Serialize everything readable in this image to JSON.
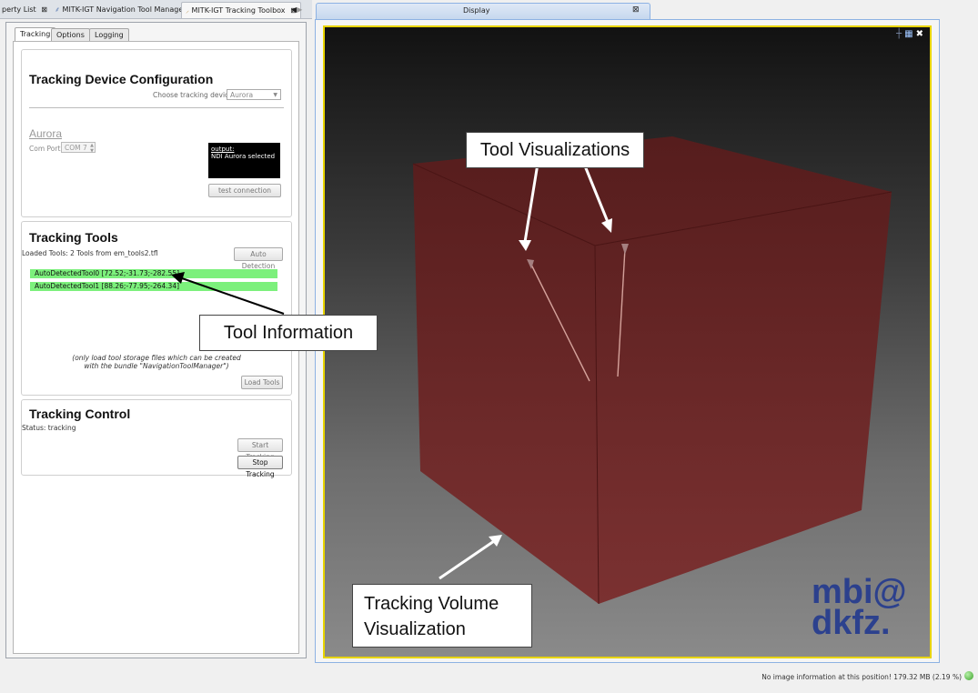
{
  "top_tabs": {
    "tab1": "perty List",
    "tab2": "MITK-IGT Navigation Tool Manager",
    "tab3": "MITK-IGT Tracking Toolbox"
  },
  "sub_tabs": [
    "Tracking",
    "Options",
    "Logging"
  ],
  "device_config": {
    "title": "Tracking Device Configuration",
    "choose_label": "Choose tracking device:",
    "device_value": "Aurora",
    "device_heading": "Aurora",
    "com_port_label": "Com Port:",
    "com_port_value": "COM 7",
    "output_heading": "output:",
    "output_text": "NDI Aurora selected",
    "test_button": "test connection"
  },
  "tracking_tools": {
    "title": "Tracking Tools",
    "loaded_text": "Loaded Tools: 2 Tools from em_tools2.tfl",
    "auto_detect_button": "Auto Detection",
    "tools": [
      "AutoDetectedTool0 [72.52;-31.73;-282.55]",
      "AutoDetectedTool1 [88.26;-77.95;-264.34]"
    ],
    "hint_line1": "(only load tool storage files which can be created",
    "hint_line2": "with the bundle \"NavigationToolManager\")",
    "load_button": "Load Tools"
  },
  "tracking_control": {
    "title": "Tracking Control",
    "status": "Status: tracking",
    "start_button": "Start Tracking",
    "stop_button": "Stop Tracking"
  },
  "display": {
    "tab_label": "Display",
    "logo_line1": "mbi@",
    "logo_line2": "dkfz."
  },
  "callouts": {
    "tool_vis": "Tool Visualizations",
    "tool_info": "Tool Information",
    "volume_line1": "Tracking Volume",
    "volume_line2": "Visualization"
  },
  "status_bar": {
    "text": "No image information at this position!  179.32 MB (2.19 %)"
  },
  "colors": {
    "tool_highlight": "#7cf07c",
    "render_border": "#e8d400",
    "volume": "#6e1e1e",
    "logo": "#233a8f"
  }
}
